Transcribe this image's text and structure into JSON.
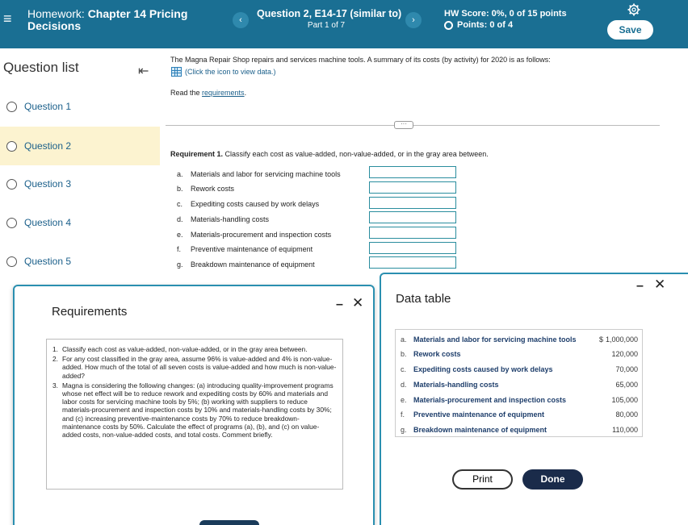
{
  "header": {
    "hw_prefix": "Homework:",
    "hw_title": "Chapter 14 Pricing Decisions",
    "question_title": "Question 2, E14-17 (similar to)",
    "question_part": "Part 1 of 7",
    "hw_score": "HW Score: 0%, 0 of 15 points",
    "points": "Points: 0 of 4",
    "save_label": "Save",
    "prev_icon": "chevron-left-icon",
    "next_icon": "chevron-right-icon"
  },
  "sidebar": {
    "title": "Question list",
    "items": [
      {
        "label": "Question 1"
      },
      {
        "label": "Question 2"
      },
      {
        "label": "Question 3"
      },
      {
        "label": "Question 4"
      },
      {
        "label": "Question 5"
      }
    ]
  },
  "main": {
    "intro": "The Magna Repair Shop repairs and services machine tools. A summary of its costs (by activity) for 2020 is as follows:",
    "data_link": "(Click the icon to view data.)",
    "read_prefix": "Read the ",
    "read_link": "requirements",
    "read_suffix": ".",
    "req1_bold": "Requirement 1.",
    "req1_text": " Classify each cost as value-added, non-value-added, or in the gray area between.",
    "costs": [
      {
        "letter": "a.",
        "label": "Materials and labor for servicing machine tools"
      },
      {
        "letter": "b.",
        "label": "Rework costs"
      },
      {
        "letter": "c.",
        "label": "Expediting costs caused by work delays"
      },
      {
        "letter": "d.",
        "label": "Materials-handling costs"
      },
      {
        "letter": "e.",
        "label": "Materials-procurement and inspection costs"
      },
      {
        "letter": "f.",
        "label": "Preventive maintenance of equipment"
      },
      {
        "letter": "g.",
        "label": "Breakdown maintenance of equipment"
      }
    ]
  },
  "requirements_popup": {
    "title": "Requirements",
    "items": [
      {
        "num": "1.",
        "text": "Classify each cost as value-added, non-value-added, or in the gray area between."
      },
      {
        "num": "2.",
        "text": "For any cost classified in the gray area, assume 96% is value-added and 4% is non-value-added. How much of the total of all seven costs is value-added and how much is non-value-added?"
      },
      {
        "num": "3.",
        "text": "Magna is considering the following changes: (a) introducing quality-improvement programs whose net effect will be to reduce rework and expediting costs by 60% and materials and labor costs for servicing machine tools by 5%; (b) working with suppliers to reduce materials-procurement and inspection costs by 10% and materials-handling costs by 30%; and (c) increasing preventive-maintenance costs by 70% to reduce breakdown-maintenance costs by 50%. Calculate the effect of programs (a), (b), and (c) on value-added costs, non-value-added costs, and total costs. Comment briefly."
      }
    ]
  },
  "data_popup": {
    "title": "Data table",
    "currency": "$",
    "rows": [
      {
        "letter": "a.",
        "label": "Materials and labor for servicing machine tools",
        "value": "1,000,000"
      },
      {
        "letter": "b.",
        "label": "Rework costs",
        "value": "120,000"
      },
      {
        "letter": "c.",
        "label": "Expediting costs caused by work delays",
        "value": "70,000"
      },
      {
        "letter": "d.",
        "label": "Materials-handling costs",
        "value": "65,000"
      },
      {
        "letter": "e.",
        "label": "Materials-procurement and inspection costs",
        "value": "105,000"
      },
      {
        "letter": "f.",
        "label": "Preventive maintenance of equipment",
        "value": "80,000"
      },
      {
        "letter": "g.",
        "label": "Breakdown maintenance of equipment",
        "value": "110,000"
      }
    ],
    "print_label": "Print",
    "done_label": "Done"
  }
}
